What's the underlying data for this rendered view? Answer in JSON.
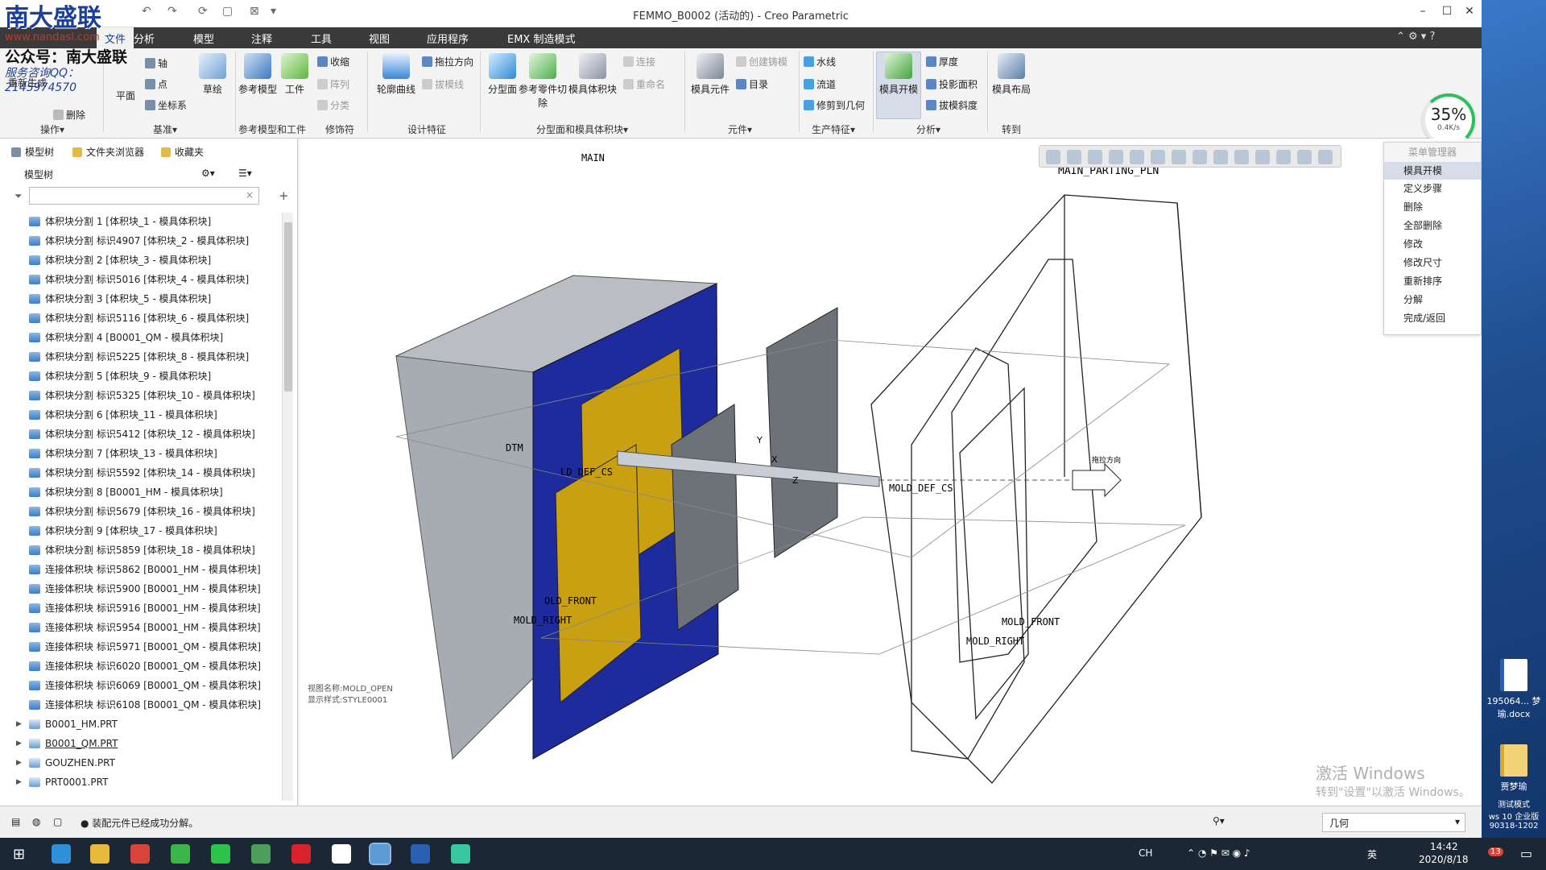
{
  "window": {
    "title": "FEMMO_B0002 (活动的) - Creo Parametric",
    "min": "–",
    "max": "☐",
    "close": "✕"
  },
  "watermark": {
    "logo": "南大盛联",
    "url": "www.nandasl.com",
    "line3": "公众号：南大盛联",
    "line4": "服务咨询QQ：2145974570"
  },
  "menu": {
    "tabs": [
      "文件",
      "分析",
      "模型",
      "注释",
      "工具",
      "视图",
      "应用程序",
      "EMX 制造模式"
    ],
    "active_index": 0,
    "right_icons": "⌃ ⚙ ▾ ?"
  },
  "ribbon": {
    "big_buttons": [
      {
        "label": "重新生成"
      },
      {
        "label": "平面"
      },
      {
        "label": "草绘"
      },
      {
        "label": "参考模型"
      },
      {
        "label": "工件"
      },
      {
        "label": "轮廓曲线"
      },
      {
        "label": "分型面"
      },
      {
        "label": "参考零件切除"
      },
      {
        "label": "模具体积块"
      },
      {
        "label": "模具元件"
      },
      {
        "label": "模具开模"
      },
      {
        "label": "模具布局"
      }
    ],
    "small_buttons": [
      "轴",
      "点",
      "坐标系",
      "删除",
      "收缩",
      "阵列",
      "分类",
      "拖拉方向",
      "拔模线",
      "连接",
      "重命名",
      "创建铸模",
      "目录",
      "水线",
      "流道",
      "修剪到几何",
      "厚度",
      "投影面积",
      "拔模斜度"
    ],
    "groups": [
      "操作▾",
      "基准▾",
      "参考模型和工件",
      "修饰符",
      "设计特征",
      "分型面和模具体积块▾",
      "元件▾",
      "生产特征▾",
      "分析▾",
      "转到"
    ]
  },
  "panel": {
    "tabs": [
      "模型树",
      "文件夹浏览器",
      "收藏夹"
    ],
    "tree_header": "模型树",
    "filter_clear": "×",
    "items": [
      "体积块分割 1 [体积块_1 - 模具体积块]",
      "体积块分割 标识4907 [体积块_2 - 模具体积块]",
      "体积块分割 2 [体积块_3 - 模具体积块]",
      "体积块分割 标识5016 [体积块_4 - 模具体积块]",
      "体积块分割 3 [体积块_5 - 模具体积块]",
      "体积块分割 标识5116 [体积块_6 - 模具体积块]",
      "体积块分割 4 [B0001_QM - 模具体积块]",
      "体积块分割 标识5225 [体积块_8 - 模具体积块]",
      "体积块分割 5 [体积块_9 - 模具体积块]",
      "体积块分割 标识5325 [体积块_10 - 模具体积块]",
      "体积块分割 6 [体积块_11 - 模具体积块]",
      "体积块分割 标识5412 [体积块_12 - 模具体积块]",
      "体积块分割 7 [体积块_13 - 模具体积块]",
      "体积块分割 标识5592 [体积块_14 - 模具体积块]",
      "体积块分割 8 [B0001_HM - 模具体积块]",
      "体积块分割 标识5679 [体积块_16 - 模具体积块]",
      "体积块分割 9 [体积块_17 - 模具体积块]",
      "体积块分割 标识5859 [体积块_18 - 模具体积块]",
      "连接体积块 标识5862 [B0001_HM - 模具体积块]",
      "连接体积块 标识5900 [B0001_HM - 模具体积块]",
      "连接体积块 标识5916 [B0001_HM - 模具体积块]",
      "连接体积块 标识5954 [B0001_HM - 模具体积块]",
      "连接体积块 标识5971 [B0001_QM - 模具体积块]",
      "连接体积块 标识6020 [B0001_QM - 模具体积块]",
      "连接体积块 标识6069 [B0001_QM - 模具体积块]",
      "连接体积块 标识6108 [B0001_QM - 模具体积块]"
    ],
    "parts": [
      "B0001_HM.PRT",
      "B0001_QM.PRT",
      "GOUZHEN.PRT",
      "PRT0001.PRT"
    ]
  },
  "graphics": {
    "labels": {
      "main_partial": "MAIN",
      "main_parting": "MAIN_PARTING_PLN",
      "dtm": "DTM",
      "mold_def_csys_partial": "LD_DEF_CS",
      "mold_front_partial": "OLD_FRONT",
      "mold_right_partial": "MOLD_RIGHT",
      "mold_def_csys": "MOLD_DEF_CS",
      "mold_front": "MOLD_FRONT",
      "mold_right": "MOLD_RIGHT",
      "pull_dir": "拖拉方向",
      "axis_y": "Y",
      "axis_z": "Z",
      "axis_x": "X"
    },
    "style_line1": "视图名称:MOLD_OPEN",
    "style_line2": "显示样式:STYLE0001",
    "colors": {
      "steel": "#a7abb2",
      "blue": "#1d2b9c",
      "gold": "#c8a012",
      "gray_plate": "#6d7178"
    }
  },
  "menu_manager": {
    "title": "菜单管理器",
    "selected": "模具开模",
    "items": [
      "定义步骤",
      "删除",
      "全部删除",
      "修改",
      "修改尺寸",
      "重新排序",
      "分解",
      "完成/返回"
    ]
  },
  "gauge": {
    "percent": "35%",
    "rate": "0.4K/s"
  },
  "windows_activation": {
    "line1": "激活 Windows",
    "line2": "转到\"设置\"以激活 Windows。"
  },
  "status": {
    "message": "● 装配元件已经成功分解。",
    "select": "几何",
    "select_arrow": "▾"
  },
  "desktop_icons": [
    {
      "label": "195064...\n梦瑜.docx"
    },
    {
      "label": "贾梦瑜"
    }
  ],
  "desktop_text": {
    "l1": "测试模式",
    "l2": "ws 10 企业版",
    "l3": "90318-1202"
  },
  "taskbar": {
    "lang": "CH",
    "ime": "英",
    "time": "14:42",
    "date": "2020/8/18",
    "notif": "13"
  }
}
